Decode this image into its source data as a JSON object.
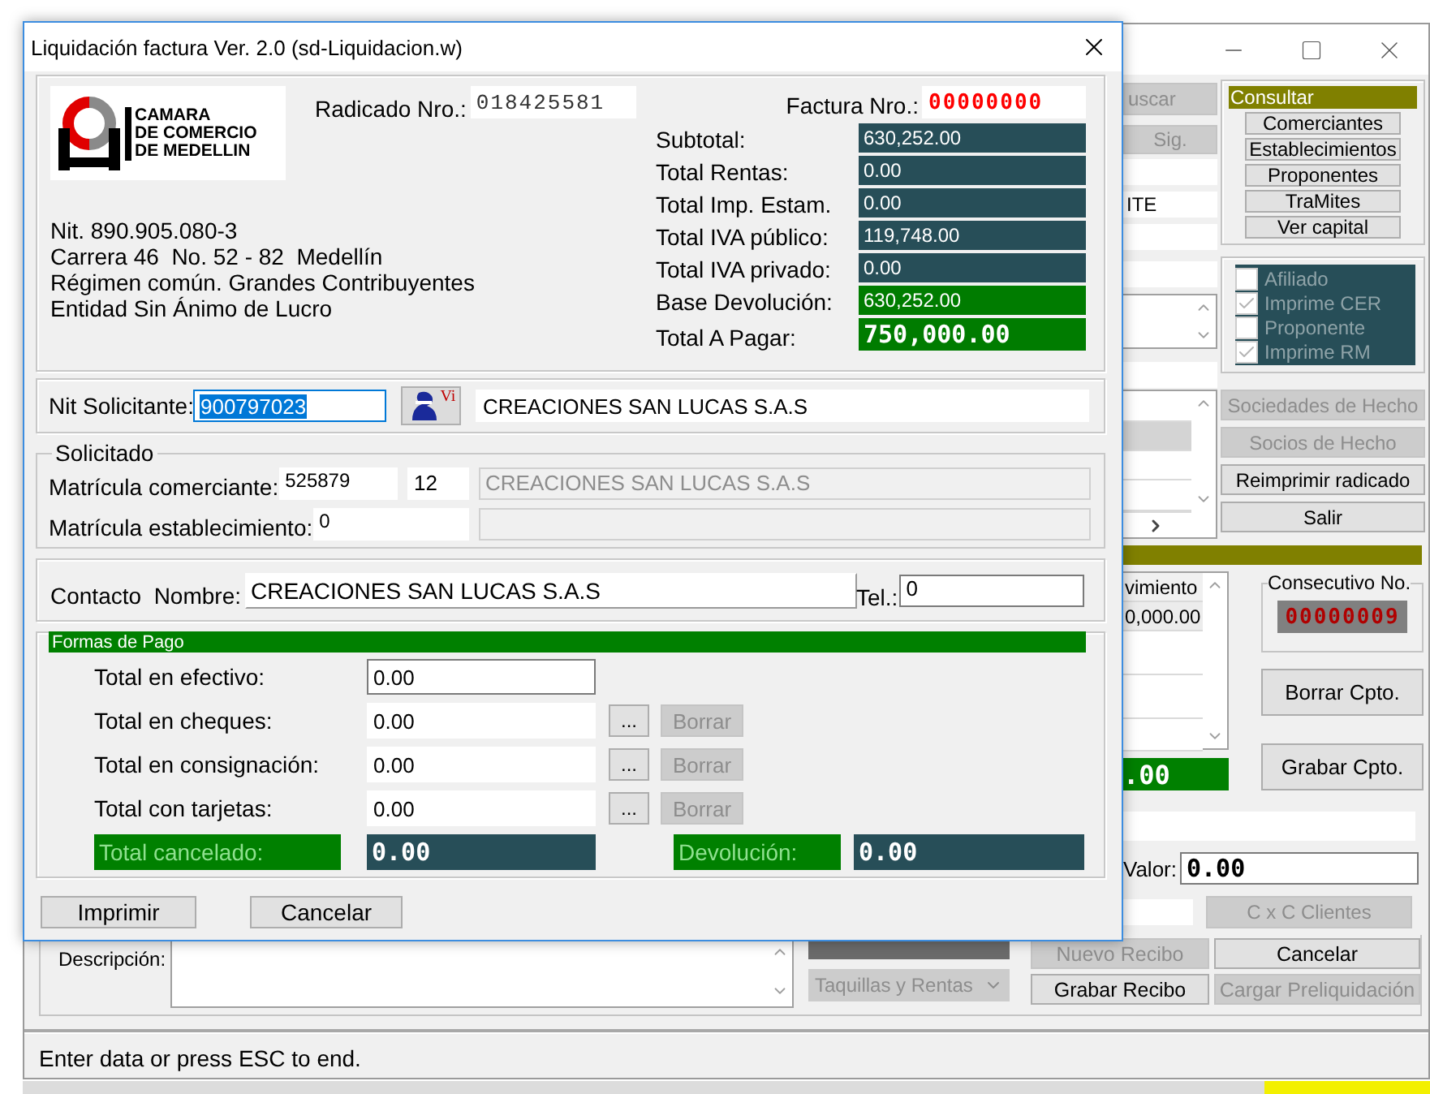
{
  "main_window": {
    "lookup_buttons": [
      {
        "label": "uscar",
        "disabled": true
      },
      {
        "label": "Sig.",
        "disabled": true
      }
    ],
    "info_field": "ITE",
    "consultar": {
      "title": "Consultar",
      "buttons": [
        "Comerciantes",
        "Establecimientos",
        "Proponentes",
        "TraMites",
        "Ver capital"
      ]
    },
    "flags": [
      {
        "label": "Afiliado",
        "checked": false
      },
      {
        "label": "Imprime CER",
        "checked": true
      },
      {
        "label": "Proponente",
        "checked": false
      },
      {
        "label": "Imprime RM",
        "checked": true
      }
    ],
    "side_buttons": [
      {
        "label": "Sociedades de Hecho",
        "disabled": true
      },
      {
        "label": "Socios de Hecho",
        "disabled": true
      },
      {
        "label": "Reimprimir radicado",
        "disabled": false
      },
      {
        "label": "Salir",
        "disabled": false
      }
    ],
    "movement_list": {
      "header": "vimiento",
      "rows": [
        "0,000.00"
      ]
    },
    "movement_total": ".00",
    "consecutivo": {
      "legend": "Consecutivo No.",
      "value": "00000009"
    },
    "concept_buttons": [
      "Borrar Cpto.",
      "Grabar Cpto."
    ],
    "valor": {
      "label": "Valor:",
      "value": "0.00"
    },
    "cxc": {
      "label": "C x C Clientes",
      "disabled": true
    },
    "descripcion": {
      "label": "Descripción:"
    },
    "cobro": {
      "value": "Taquillas y Rentas",
      "disabled": true
    },
    "receipt_buttons": [
      {
        "label": "Nuevo Recibo",
        "disabled": true
      },
      {
        "label": "Cancelar",
        "disabled": false
      },
      {
        "label": "Grabar Recibo",
        "disabled": false
      },
      {
        "label": "Cargar Preliquidación",
        "disabled": true
      }
    ],
    "status_bar": "Enter data or press ESC to end."
  },
  "dialog": {
    "title": "Liquidación factura Ver. 2.0 (sd-Liquidacion.w)",
    "logo": {
      "lines": [
        "CAMARA",
        "DE COMERCIO",
        "DE MEDELLIN"
      ]
    },
    "radicado": {
      "label": "Radicado Nro.:",
      "value": "018425581"
    },
    "factura": {
      "label": "Factura Nro.:",
      "value": "00000000"
    },
    "company_lines": [
      "Nit. 890.905.080-3",
      "Carrera 46  No. 52 - 82  Medellín",
      "Régimen común. Grandes Contribuyentes",
      "Entidad Sin Ánimo de Lucro"
    ],
    "totals": [
      {
        "label": "Subtotal:",
        "value": "630,252.00",
        "kind": "plain"
      },
      {
        "label": "Total Rentas:",
        "value": "0.00",
        "kind": "plain"
      },
      {
        "label": "Total Imp. Estam.",
        "value": "0.00",
        "kind": "plain"
      },
      {
        "label": "Total IVA público:",
        "value": "119,748.00",
        "kind": "plain"
      },
      {
        "label": "Total IVA privado:",
        "value": "0.00",
        "kind": "plain"
      },
      {
        "label": "Base Devolución:",
        "value": "630,252.00",
        "kind": "highlight"
      },
      {
        "label": "Total A Pagar:",
        "value": "750,000.00",
        "kind": "grand"
      }
    ],
    "nit": {
      "label": "Nit Solicitante:",
      "value": "900797023",
      "selected": true,
      "lookup_text": "Vi",
      "name": "CREACIONES SAN LUCAS S.A.S"
    },
    "solicitado": {
      "legend": "Solicitado",
      "rows": [
        {
          "label": "Matrícula comerciante:",
          "value": "525879",
          "code": "12",
          "name": "CREACIONES SAN LUCAS S.A.S"
        },
        {
          "label": "Matrícula establecimiento:",
          "value": "0"
        }
      ]
    },
    "contacto": {
      "label": "Contacto  Nombre:",
      "value": "CREACIONES SAN LUCAS S.A.S",
      "tel_label": "Tel.:",
      "tel_value": "0"
    },
    "formas_de_pago": {
      "title": "Formas de Pago",
      "rows": [
        {
          "label": "Total en efectivo:",
          "value": "0.00",
          "kind": "cash"
        },
        {
          "label": "Total en cheques:",
          "value": "0.00",
          "kind": "detail",
          "more": "...",
          "action": "Borrar",
          "action_disabled": true
        },
        {
          "label": "Total en consignación:",
          "value": "0.00",
          "kind": "detail",
          "more": "...",
          "action": "Borrar",
          "action_disabled": true
        },
        {
          "label": "Total con tarjetas:",
          "value": "0.00",
          "kind": "detail",
          "more": "...",
          "action": "Borrar",
          "action_disabled": true
        }
      ],
      "summary": [
        {
          "label": "Total cancelado:",
          "value": "0.00"
        },
        {
          "label": "Devolución:",
          "value": "0.00"
        }
      ]
    },
    "buttons": [
      "Imprimir",
      "Cancelar"
    ]
  }
}
